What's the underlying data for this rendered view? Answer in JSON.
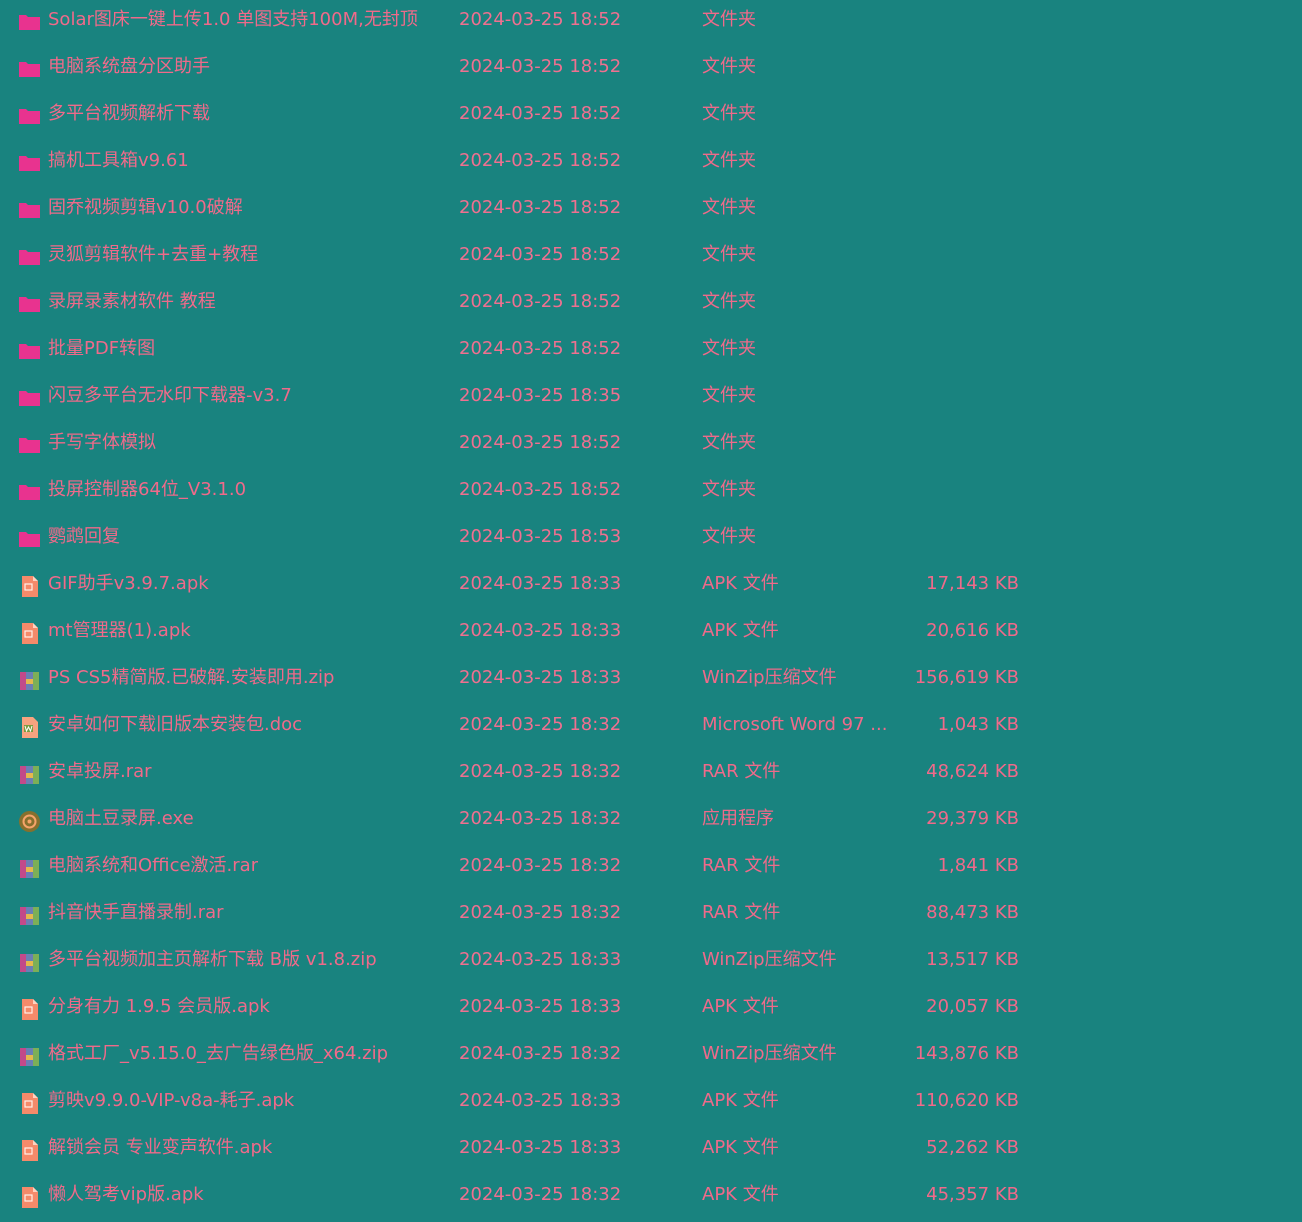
{
  "colors": {
    "background": "#19837f",
    "text": "#f06a8a",
    "folder": "#e8338f",
    "apk": "#f58a6a",
    "archive_a": "#c24a8a",
    "archive_b": "#6a7fb5",
    "archive_c": "#7caf57",
    "doc_page": "#f7a37f",
    "doc_mark": "#7b9c3e",
    "exe_circle": "#85702e",
    "exe_glyph": "#f6a46a"
  },
  "files": [
    {
      "icon": "folder-icon",
      "name": "Solar图床一键上传1.0 单图支持100M,无封顶",
      "date": "2024-03-25 18:52",
      "type": "文件夹",
      "size": ""
    },
    {
      "icon": "folder-icon",
      "name": "电脑系统盘分区助手",
      "date": "2024-03-25 18:52",
      "type": "文件夹",
      "size": ""
    },
    {
      "icon": "folder-icon",
      "name": "多平台视频解析下载",
      "date": "2024-03-25 18:52",
      "type": "文件夹",
      "size": ""
    },
    {
      "icon": "folder-icon",
      "name": "搞机工具箱v9.61",
      "date": "2024-03-25 18:52",
      "type": "文件夹",
      "size": ""
    },
    {
      "icon": "folder-icon",
      "name": "固乔视频剪辑v10.0破解",
      "date": "2024-03-25 18:52",
      "type": "文件夹",
      "size": ""
    },
    {
      "icon": "folder-icon",
      "name": "灵狐剪辑软件+去重+教程",
      "date": "2024-03-25 18:52",
      "type": "文件夹",
      "size": ""
    },
    {
      "icon": "folder-icon",
      "name": "录屏录素材软件 教程",
      "date": "2024-03-25 18:52",
      "type": "文件夹",
      "size": ""
    },
    {
      "icon": "folder-icon",
      "name": "批量PDF转图",
      "date": "2024-03-25 18:52",
      "type": "文件夹",
      "size": ""
    },
    {
      "icon": "folder-icon",
      "name": "闪豆多平台无水印下载器-v3.7",
      "date": "2024-03-25 18:35",
      "type": "文件夹",
      "size": ""
    },
    {
      "icon": "folder-icon",
      "name": "手写字体模拟",
      "date": "2024-03-25 18:52",
      "type": "文件夹",
      "size": ""
    },
    {
      "icon": "folder-icon",
      "name": "投屏控制器64位_V3.1.0",
      "date": "2024-03-25 18:52",
      "type": "文件夹",
      "size": ""
    },
    {
      "icon": "folder-icon",
      "name": "鹦鹉回复",
      "date": "2024-03-25 18:53",
      "type": "文件夹",
      "size": ""
    },
    {
      "icon": "apk-file-icon",
      "name": "GIF助手v3.9.7.apk",
      "date": "2024-03-25 18:33",
      "type": "APK 文件",
      "size": "17,143 KB"
    },
    {
      "icon": "apk-file-icon",
      "name": "mt管理器(1).apk",
      "date": "2024-03-25 18:33",
      "type": "APK 文件",
      "size": "20,616 KB"
    },
    {
      "icon": "archive-icon",
      "name": "PS CS5精简版.已破解.安装即用.zip",
      "date": "2024-03-25 18:33",
      "type": "WinZip压缩文件",
      "size": "156,619 KB"
    },
    {
      "icon": "word-doc-icon",
      "name": "安卓如何下载旧版本安装包.doc",
      "date": "2024-03-25 18:32",
      "type": "Microsoft Word 97 ...",
      "size": "1,043 KB"
    },
    {
      "icon": "archive-icon",
      "name": "安卓投屏.rar",
      "date": "2024-03-25 18:32",
      "type": "RAR 文件",
      "size": "48,624 KB"
    },
    {
      "icon": "exe-app-icon",
      "name": "电脑土豆录屏.exe",
      "date": "2024-03-25 18:32",
      "type": "应用程序",
      "size": "29,379 KB"
    },
    {
      "icon": "archive-icon",
      "name": "电脑系统和Office激活.rar",
      "date": "2024-03-25 18:32",
      "type": "RAR 文件",
      "size": "1,841 KB"
    },
    {
      "icon": "archive-icon",
      "name": "抖音快手直播录制.rar",
      "date": "2024-03-25 18:32",
      "type": "RAR 文件",
      "size": "88,473 KB"
    },
    {
      "icon": "archive-icon",
      "name": "多平台视频加主页解析下载 B版 v1.8.zip",
      "date": "2024-03-25 18:33",
      "type": "WinZip压缩文件",
      "size": "13,517 KB"
    },
    {
      "icon": "apk-file-icon",
      "name": "分身有力 1.9.5 会员版.apk",
      "date": "2024-03-25 18:33",
      "type": "APK 文件",
      "size": "20,057 KB"
    },
    {
      "icon": "archive-icon",
      "name": "格式工厂_v5.15.0_去广告绿色版_x64.zip",
      "date": "2024-03-25 18:32",
      "type": "WinZip压缩文件",
      "size": "143,876 KB"
    },
    {
      "icon": "apk-file-icon",
      "name": "剪映v9.9.0-VIP-v8a-耗子.apk",
      "date": "2024-03-25 18:33",
      "type": "APK 文件",
      "size": "110,620 KB"
    },
    {
      "icon": "apk-file-icon",
      "name": "解锁会员 专业变声软件.apk",
      "date": "2024-03-25 18:33",
      "type": "APK 文件",
      "size": "52,262 KB"
    },
    {
      "icon": "apk-file-icon",
      "name": "懒人驾考vip版.apk",
      "date": "2024-03-25 18:32",
      "type": "APK 文件",
      "size": "45,357 KB"
    }
  ]
}
